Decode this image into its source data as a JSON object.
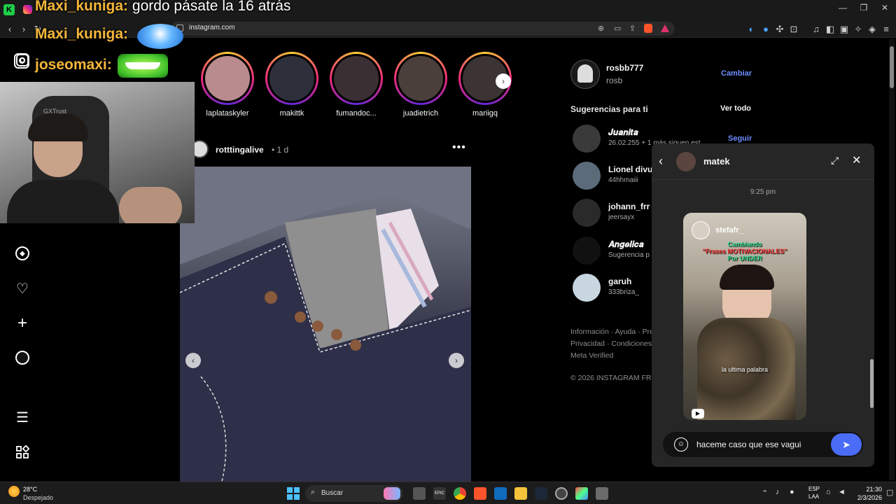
{
  "browser": {
    "url": "instagram.com",
    "tab_icon": "instagram-icon"
  },
  "overlay_chat": [
    {
      "user": "Maxi_kuniga:",
      "message": "gordo pásate la 16 atrás"
    },
    {
      "user": "Maxi_kuniga:",
      "message": ""
    },
    {
      "user": "joseomaxi:",
      "message": ""
    }
  ],
  "stories": [
    {
      "name": "laplataskyler",
      "color": "#b98a8e"
    },
    {
      "name": "makittk",
      "color": "#2d2f3a"
    },
    {
      "name": "fumandoc...",
      "color": "#3a3034"
    },
    {
      "name": "juadietrich",
      "color": "#4a3f3b"
    },
    {
      "name": "mariigq",
      "color": "#3c3333"
    }
  ],
  "post": {
    "username": "rotttingalive",
    "time": "• 1 d",
    "more_icon": "more-horizontal-icon"
  },
  "account": {
    "username": "rosbb777",
    "name": "rosb",
    "switch_label": "Cambiar"
  },
  "suggestions": {
    "title": "Sugerencias para ti",
    "see_all": "Ver todo",
    "follow_label": "Seguir",
    "items": [
      {
        "name": "𝑱𝒖𝒂𝒏𝒊𝒕𝒂",
        "sub": "26.02.255 + 1 más siguen est"
      },
      {
        "name": "Lionel divu",
        "sub": "44hhmaiii"
      },
      {
        "name": "johann_frr",
        "sub": "jeersayx"
      },
      {
        "name": "𝑨𝒏𝒈𝒆𝒍𝒊𝒄𝒂",
        "sub": "Sugerencia p"
      },
      {
        "name": "garuh",
        "sub": "333briza_"
      }
    ]
  },
  "footer": {
    "line1": "Información · Ayuda · Pre",
    "line2": "Privacidad · Condiciones",
    "line3": "Meta Verified",
    "copyright": "© 2026 INSTAGRAM FRO"
  },
  "dm": {
    "contact": "matek",
    "time": "9:25 pm",
    "reel_user": "stefafr_",
    "reel_caption_top": "Cambiando",
    "reel_caption_mid": "\"Frases MOTIVACIONALES\"",
    "reel_caption_bot": "Por UNDER",
    "reel_subtitle": "la ultima palabra",
    "input_text": "haceme caso que ese vagui"
  },
  "taskbar": {
    "weather_temp": "28°C",
    "weather_desc": "Despejado",
    "search_label": "Buscar",
    "lang1": "ESP",
    "lang2": "LAA",
    "time": "21:30",
    "date": "2/3/2026"
  }
}
